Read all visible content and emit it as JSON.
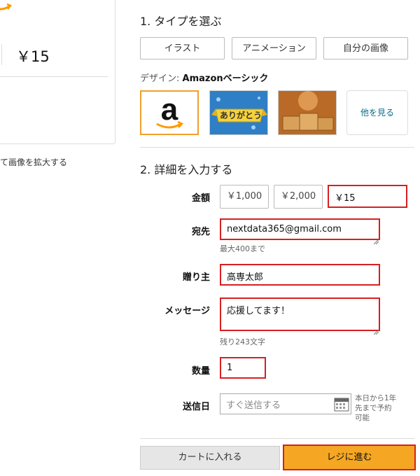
{
  "preview": {
    "logo_text": "a",
    "amount": "￥15",
    "zoom_hint": "て画像を拡大する"
  },
  "step1": {
    "title": "1. タイプを選ぶ",
    "type_buttons": [
      "イラスト",
      "アニメーション",
      "自分の画像"
    ],
    "design_label": "デザイン:",
    "design_value": "Amazonベーシック",
    "thumbnails": [
      {
        "name": "amazon-logo"
      },
      {
        "name": "arigatou",
        "text": "ありがとう"
      },
      {
        "name": "boxes"
      }
    ],
    "see_more": "他を見る"
  },
  "step2": {
    "title": "2. 詳細を入力する",
    "amount_label": "金額",
    "amount_options": [
      "￥1,000",
      "￥2,000"
    ],
    "amount_value": "￥15",
    "to_label": "宛先",
    "to_value": "nextdata365@gmail.com",
    "to_hint": "最大400まで",
    "from_label": "贈り主",
    "from_value": "高専太郎",
    "message_label": "メッセージ",
    "message_value": "応援してます！",
    "message_hint": "残り243文字",
    "qty_label": "数量",
    "qty_value": "1",
    "date_label": "送信日",
    "date_placeholder": "すぐ送信する",
    "date_hint": "本日から1年先まで予約可能"
  },
  "actions": {
    "cart": "カートに入れる",
    "checkout": "レジに進む"
  },
  "colors": {
    "accent": "#f5a623",
    "highlight_border": "#d62020",
    "amazon_orange": "#ff9900"
  }
}
